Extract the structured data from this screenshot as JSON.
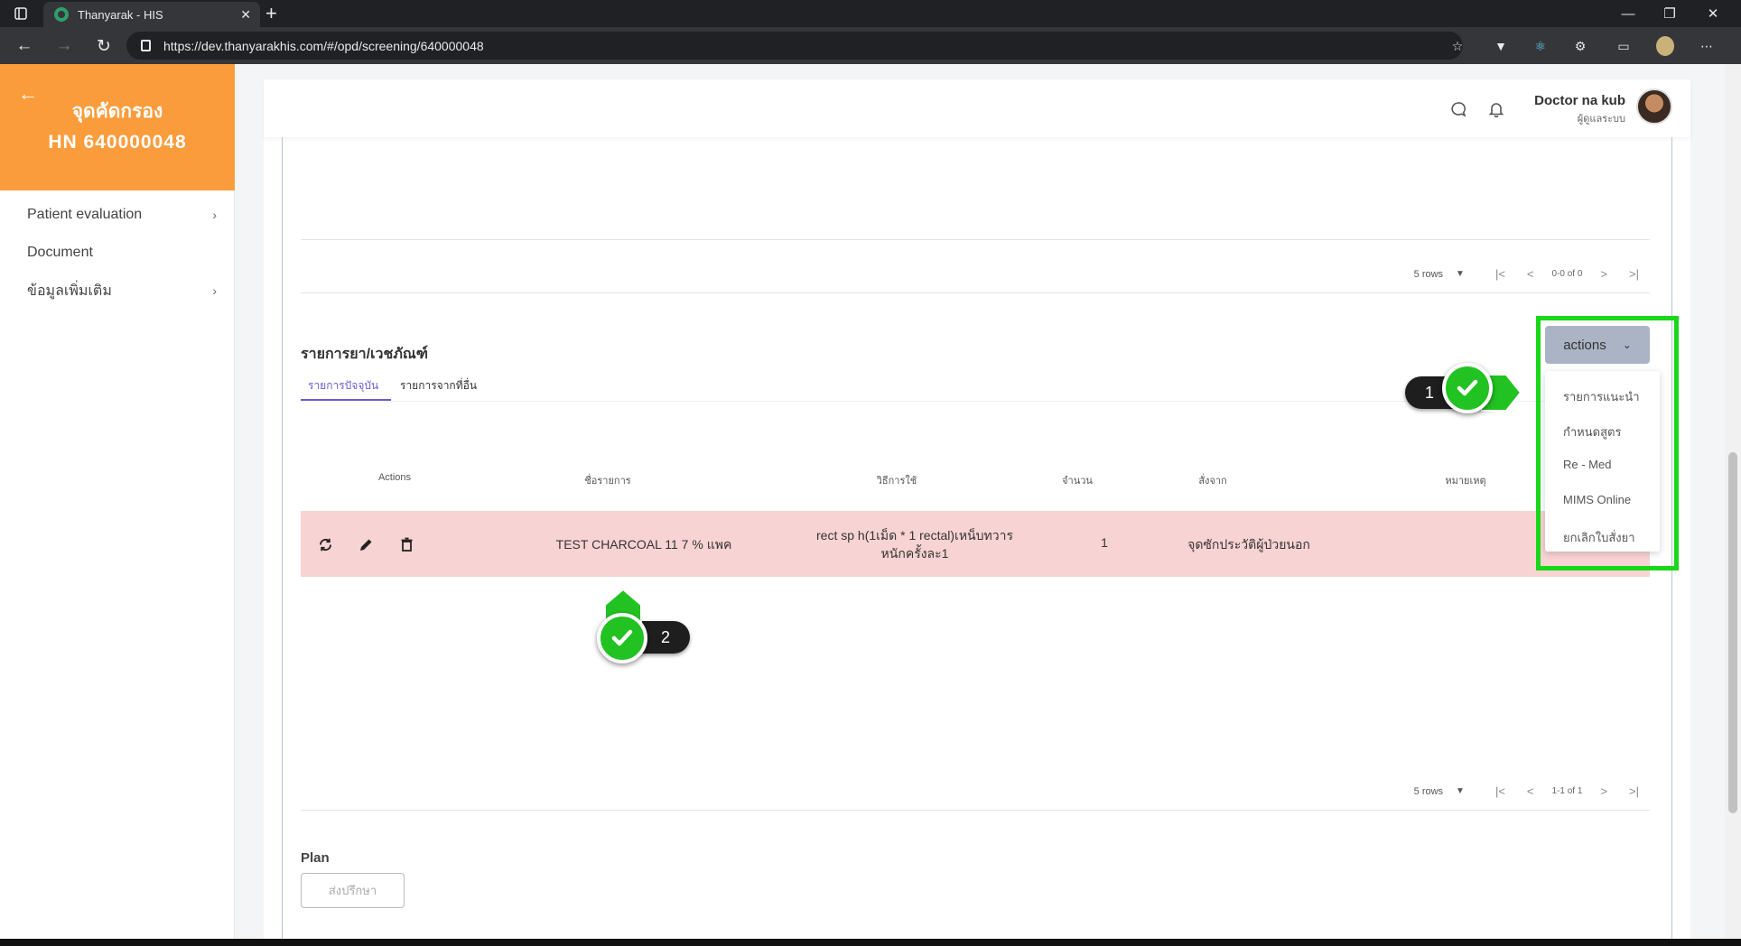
{
  "browser": {
    "tab_title": "Thanyarak - HIS",
    "url": "https://dev.thanyarakhis.com/#/opd/screening/640000048",
    "accent": "#35363a"
  },
  "sidebar": {
    "title": "จุดคัดกรอง",
    "hn": "HN 640000048",
    "header_color": "#fa9c3c",
    "items": [
      {
        "label": "Patient evaluation",
        "has_chevron": true
      },
      {
        "label": "Document",
        "has_chevron": false
      },
      {
        "label": "ข้อมูลเพิ่มเติม",
        "has_chevron": true
      }
    ]
  },
  "topbar": {
    "user_name": "Doctor na kub",
    "user_role": "ผู้ดูแลระบบ",
    "icons": [
      "chat-icon",
      "bell-icon"
    ]
  },
  "pager_top": {
    "rows": "5 rows",
    "info": "0-0 of 0"
  },
  "pager_bottom": {
    "rows": "5 rows",
    "info": "1-1 of 1"
  },
  "medication": {
    "section_title": "รายการยา/เวชภัณฑ์",
    "tabs": [
      {
        "label": "รายการปัจจุบัน",
        "active": true
      },
      {
        "label": "รายการจากที่อื่น",
        "active": false
      }
    ],
    "columns": [
      "Actions",
      "ชื่อรายการ",
      "วิธีการใช้",
      "จำนวน",
      "สั่งจาก",
      "หมายเหตุ"
    ],
    "rows": [
      {
        "name": "TEST CHARCOAL 11 7 % แพค",
        "usage_line1": "rect sp h(1เม็ด * 1 rectal)เหน็บทวาร",
        "usage_line2": "หนักครั้งละ1",
        "qty": "1",
        "ordered_from": "จุดซักประวัติผู้ป่วยนอก",
        "note": ""
      }
    ],
    "row_color": "#f8d3d3"
  },
  "actions_dropdown": {
    "label": "actions",
    "items": [
      "รายการแนะนำ",
      "กำหนดสูตร",
      "Re - Med",
      "MIMS Online",
      "ยกเลิกใบสั่งยา"
    ]
  },
  "plan": {
    "label": "Plan",
    "consult_button": "ส่งปรึกษา"
  },
  "annotations": {
    "marker1": "1",
    "marker2": "2",
    "highlight_color": "#19d719"
  }
}
